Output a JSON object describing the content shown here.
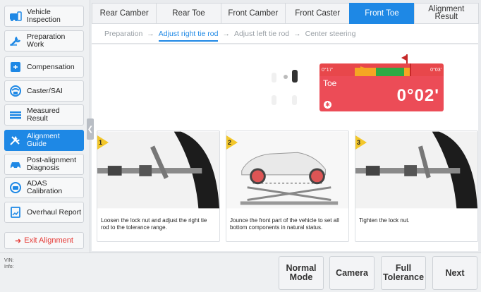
{
  "sidebar": {
    "items": [
      {
        "label": "Vehicle\nInspection",
        "icon": "car-inspection-icon",
        "color": "#1e88e5"
      },
      {
        "label": "Preparation\nWork",
        "icon": "wrench-icon",
        "color": "#1e88e5"
      },
      {
        "label": "Compensation",
        "icon": "compensation-icon",
        "color": "#1e88e5"
      },
      {
        "label": "Caster/SAI",
        "icon": "caster-icon",
        "color": "#1e88e5"
      },
      {
        "label": "Measured\nResult",
        "icon": "list-icon",
        "color": "#1e88e5"
      },
      {
        "label": "Alignment\nGuide",
        "icon": "tools-icon",
        "color": "#ffffff"
      },
      {
        "label": "Post-alignment\nDiagnosis",
        "icon": "car-diagnosis-icon",
        "color": "#1e88e5"
      },
      {
        "label": "ADAS\nCalibration",
        "icon": "adas-icon",
        "color": "#1e88e5"
      },
      {
        "label": "Overhaul Report",
        "icon": "report-icon",
        "color": "#1e88e5"
      }
    ],
    "exit_label": "Exit Alignment"
  },
  "tabs": [
    {
      "label": "Rear Camber"
    },
    {
      "label": "Rear Toe"
    },
    {
      "label": "Front Camber"
    },
    {
      "label": "Front Caster"
    },
    {
      "label": "Front Toe"
    },
    {
      "label": "Alignment\nResult"
    }
  ],
  "steps": [
    {
      "label": "Preparation"
    },
    {
      "label": "Adjust right tie rod"
    },
    {
      "label": "Adjust left tie rod"
    },
    {
      "label": "Center steering"
    }
  ],
  "gauge": {
    "left_limit": "0°17'",
    "right_limit": "0°03'",
    "label": "Toe",
    "value": "0°02'",
    "status_color": "#ec4c57"
  },
  "cards": [
    {
      "num": "1",
      "text": "Loosen the lock nut and adjust the right tie rod to the tolerance range."
    },
    {
      "num": "2",
      "text": "Jounce the front part of the vehicle to set all bottom components in natural status."
    },
    {
      "num": "3",
      "text": "Tighten the lock nut."
    }
  ],
  "footer": {
    "vin_label": "VIN:",
    "info_label": "Info:",
    "buttons": [
      "Normal\nMode",
      "Camera",
      "Full\nTolerance",
      "Next"
    ]
  },
  "colors": {
    "accent": "#1e88e5",
    "danger": "#e53935"
  }
}
